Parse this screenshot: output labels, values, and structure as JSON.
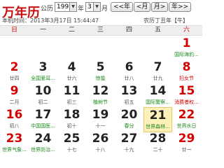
{
  "header": {
    "logo": "万年历",
    "calendar_type_label": "公历",
    "year_value": "1997",
    "year_suffix": "年",
    "month_value": "3",
    "month_suffix": "月",
    "prev_year_label": "<<年",
    "next_year_label": "年>>",
    "prev_month_label": "<月",
    "next_month_label": "月>",
    "current_time_label": "本机时间：",
    "current_time": "2013年3月17日 15:44:47",
    "lunar_info": "农历丁丑年【牛】"
  },
  "weekdays": [
    "日",
    "一",
    "二",
    "三",
    "四",
    "五",
    "六"
  ],
  "weeks": [
    [
      null,
      null,
      null,
      null,
      null,
      null,
      {
        "day": "1",
        "sub": "国际海豹...",
        "red": true,
        "sub_color": "green"
      }
    ],
    [
      {
        "day": "2",
        "sub": "廿四",
        "red": true
      },
      {
        "day": "3",
        "sub": "全国爱耳...",
        "sub_color": "green"
      },
      {
        "day": "4",
        "sub": "廿六"
      },
      {
        "day": "5",
        "sub": "惊蛰",
        "sub_color": "green"
      },
      {
        "day": "6",
        "sub": "廿八"
      },
      {
        "day": "7",
        "sub": "廿九"
      },
      {
        "day": "8",
        "sub": "妇女节",
        "red": true,
        "sub_color": "red"
      }
    ],
    [
      {
        "day": "9",
        "sub": "二月",
        "red": true
      },
      {
        "day": "10",
        "sub": "初二"
      },
      {
        "day": "11",
        "sub": "初三"
      },
      {
        "day": "12",
        "sub": "植树节",
        "sub_color": "green"
      },
      {
        "day": "13",
        "sub": "初五"
      },
      {
        "day": "14",
        "sub": "国际警察...",
        "sub_color": "green"
      },
      {
        "day": "15",
        "sub": "消费者权...",
        "red": true,
        "sub_color": "red"
      }
    ],
    [
      {
        "day": "16",
        "sub": "初八",
        "red": true
      },
      {
        "day": "17",
        "sub": "中国国医...",
        "sub_color": "green"
      },
      {
        "day": "18",
        "sub": "初十"
      },
      {
        "day": "19",
        "sub": "十一"
      },
      {
        "day": "20",
        "sub": "春分",
        "sub_color": "green"
      },
      {
        "day": "21",
        "sub": "世界森林...",
        "sub_color": "green",
        "today": true
      },
      {
        "day": "22",
        "sub": "世界水日",
        "red": true,
        "sub_color": "green"
      }
    ],
    [
      {
        "day": "23",
        "sub": "世界气象...",
        "red": true,
        "sub_color": "green"
      },
      {
        "day": "24",
        "sub": "世界防治...",
        "sub_color": "green"
      },
      {
        "day": "25",
        "sub": "十七"
      },
      {
        "day": "26",
        "sub": "十八"
      },
      {
        "day": "27",
        "sub": "十九"
      },
      {
        "day": "28",
        "sub": "二十"
      },
      {
        "day": "29",
        "sub": "廿一",
        "red": true
      }
    ]
  ]
}
